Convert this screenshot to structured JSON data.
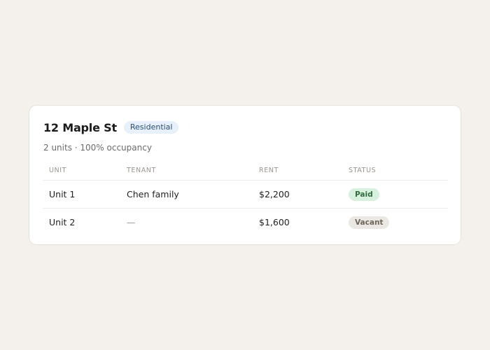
{
  "property": {
    "name": "12 Maple St",
    "type_badge": "Residential",
    "summary": "2 units · 100% occupancy"
  },
  "table": {
    "headers": {
      "unit": "UNIT",
      "tenant": "TENANT",
      "rent": "RENT",
      "status": "STATUS"
    },
    "rows": [
      {
        "unit": "Unit 1",
        "tenant": "Chen family",
        "rent": "$2,200",
        "status": "Paid"
      },
      {
        "unit": "Unit 2",
        "tenant": "—",
        "rent": "$1,600",
        "status": "Vacant"
      }
    ]
  },
  "colors": {
    "paid_bg": "#d8f1df",
    "paid_text": "#2f6b3e",
    "vacant_bg": "#ebe7e2",
    "vacant_text": "#6d665d",
    "badge_bg": "#e7f0fb",
    "badge_text": "#2a4f7a"
  }
}
